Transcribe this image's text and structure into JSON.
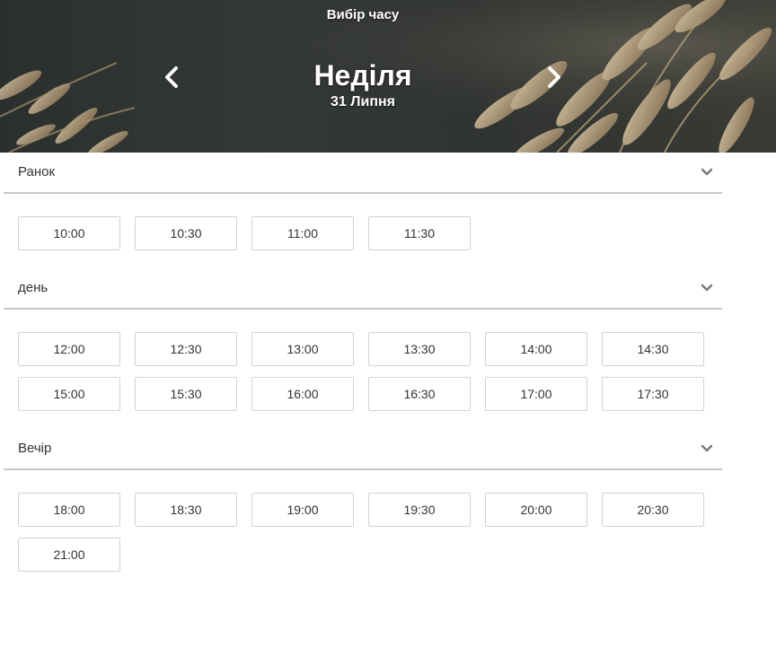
{
  "header": {
    "title": "Вибір часу",
    "day_name": "Неділя",
    "date": "31 Липня"
  },
  "icons": {
    "prev": "chevron-left-icon",
    "next": "chevron-right-icon",
    "collapse": "chevron-down-icon"
  },
  "sections": [
    {
      "label": "Ранок",
      "slots": [
        "10:00",
        "10:30",
        "11:00",
        "11:30"
      ]
    },
    {
      "label": "день",
      "slots": [
        "12:00",
        "12:30",
        "13:00",
        "13:30",
        "14:00",
        "14:30",
        "15:00",
        "15:30",
        "16:00",
        "16:30",
        "17:00",
        "17:30"
      ]
    },
    {
      "label": "Вечір",
      "slots": [
        "18:00",
        "18:30",
        "19:00",
        "19:30",
        "20:00",
        "20:30",
        "21:00"
      ]
    }
  ],
  "colors": {
    "slot_border": "#d3d3d3",
    "divider": "#c8c8c8",
    "text": "#333333"
  }
}
